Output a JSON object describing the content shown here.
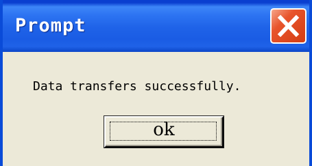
{
  "dialog": {
    "title": "Prompt",
    "message": "Data transfers successfully.",
    "ok_label": "ok",
    "close_icon": "close-icon"
  },
  "colors": {
    "title_bar": "#1f63e8",
    "window_border": "#0a4bd8",
    "close_button": "#e8552c",
    "body_background": "#ece9d8"
  }
}
